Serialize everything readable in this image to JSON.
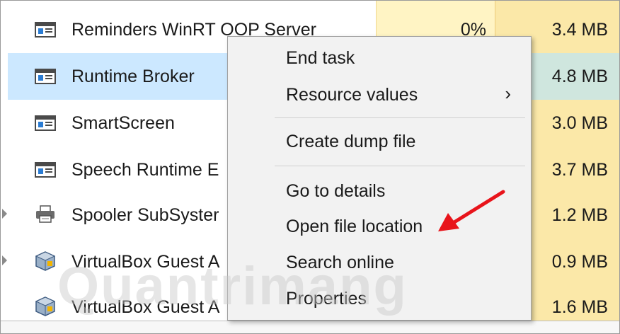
{
  "processes": [
    {
      "name": "Reminders WinRT OOP Server",
      "cpu": "0%",
      "memory": "3.4 MB",
      "icon": "app-window-icon",
      "selected": false,
      "expandable": false
    },
    {
      "name": "Runtime Broker",
      "cpu": "",
      "memory": "4.8 MB",
      "icon": "app-window-icon",
      "selected": true,
      "expandable": false
    },
    {
      "name": "SmartScreen",
      "cpu": "",
      "memory": "3.0 MB",
      "icon": "app-window-icon",
      "selected": false,
      "expandable": false
    },
    {
      "name": "Speech Runtime E",
      "cpu": "",
      "memory": "3.7 MB",
      "icon": "app-window-icon",
      "selected": false,
      "expandable": false
    },
    {
      "name": "Spooler SubSyster",
      "cpu": "",
      "memory": "1.2 MB",
      "icon": "printer-icon",
      "selected": false,
      "expandable": true
    },
    {
      "name": "VirtualBox Guest A",
      "cpu": "",
      "memory": "0.9 MB",
      "icon": "virtualbox-icon",
      "selected": false,
      "expandable": true
    },
    {
      "name": "VirtualBox Guest A",
      "cpu": "",
      "memory": "1.6 MB",
      "icon": "virtualbox-icon",
      "selected": false,
      "expandable": false
    }
  ],
  "context_menu": {
    "end_task": "End task",
    "resource_values": "Resource values",
    "resource_values_arrow": "›",
    "create_dump_file": "Create dump file",
    "go_to_details": "Go to details",
    "open_file_location": "Open file location",
    "search_online": "Search online",
    "properties": "Properties"
  },
  "watermark": "Quantrimang",
  "colors": {
    "selection": "#cce8ff",
    "cpu_column": "#fff4c4",
    "memory_column": "#fbe8a8",
    "annotation_arrow": "#e8141b"
  }
}
